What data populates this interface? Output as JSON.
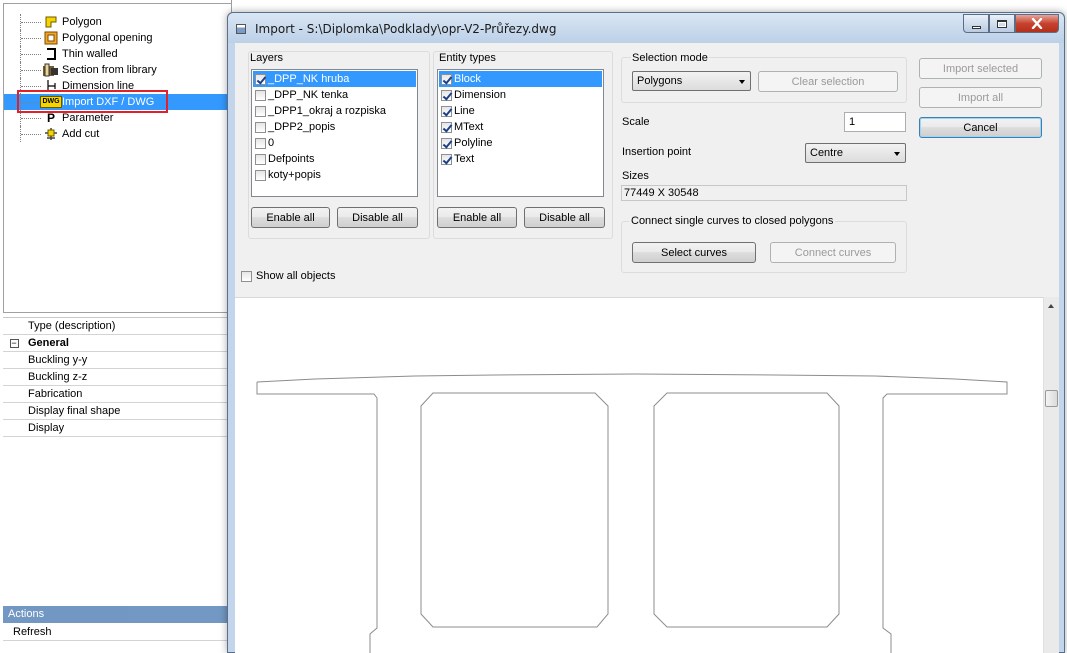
{
  "tree": {
    "items": [
      {
        "label": "Polygon",
        "icon": "polygon-icon"
      },
      {
        "label": "Polygonal opening",
        "icon": "polygonal-opening-icon"
      },
      {
        "label": "Thin walled",
        "icon": "thin-walled-icon"
      },
      {
        "label": "Section from library",
        "icon": "section-library-icon"
      },
      {
        "label": "Dimension line",
        "icon": "dimension-line-icon"
      },
      {
        "label": "Import DXF / DWG",
        "icon": "dwg-icon",
        "icon_text": "DWG",
        "selected": true
      },
      {
        "label": "Parameter",
        "icon": "parameter-icon",
        "icon_text": "P"
      },
      {
        "label": "Add cut",
        "icon": "add-cut-icon"
      }
    ]
  },
  "properties": {
    "rows": [
      {
        "label": "Type (description)"
      },
      {
        "label": "General",
        "group": true,
        "toggle": "−"
      },
      {
        "label": "Buckling y-y"
      },
      {
        "label": "Buckling z-z"
      },
      {
        "label": "Fabrication"
      },
      {
        "label": "Display final shape"
      },
      {
        "label": "Display"
      }
    ]
  },
  "actions": {
    "header": "Actions",
    "refresh": "Refresh"
  },
  "dialog": {
    "title": "Import - S:\\Diplomka\\Podklady\\opr-V2-Průřezy.dwg",
    "layers": {
      "label": "Layers",
      "items": [
        {
          "label": "_DPP_NK hruba",
          "checked": true,
          "selected": true
        },
        {
          "label": "_DPP_NK tenka",
          "checked": false
        },
        {
          "label": "_DPP1_okraj a rozpiska",
          "checked": false
        },
        {
          "label": "_DPP2_popis",
          "checked": false
        },
        {
          "label": "0",
          "checked": false
        },
        {
          "label": "Defpoints",
          "checked": false
        },
        {
          "label": "koty+popis",
          "checked": false
        }
      ],
      "enable_all": "Enable all",
      "disable_all": "Disable all"
    },
    "entity_types": {
      "label": "Entity types",
      "items": [
        {
          "label": "Block",
          "checked": true,
          "selected": true
        },
        {
          "label": "Dimension",
          "checked": true
        },
        {
          "label": "Line",
          "checked": true
        },
        {
          "label": "MText",
          "checked": true
        },
        {
          "label": "Polyline",
          "checked": true
        },
        {
          "label": "Text",
          "checked": true
        }
      ],
      "enable_all": "Enable all",
      "disable_all": "Disable all"
    },
    "selection_mode": {
      "label": "Selection mode",
      "value": "Polygons",
      "clear_selection": "Clear selection"
    },
    "scale": {
      "label": "Scale",
      "value": "1"
    },
    "insertion_point": {
      "label": "Insertion point",
      "value": "Centre"
    },
    "sizes": {
      "label": "Sizes",
      "value": "77449 X 30548"
    },
    "connect": {
      "label": "Connect single curves to closed polygons",
      "select_curves": "Select curves",
      "connect_curves": "Connect curves"
    },
    "show_all_objects": {
      "label": "Show all objects",
      "checked": false
    },
    "buttons": {
      "import_selected": "Import selected",
      "import_all": "Import all",
      "cancel": "Cancel"
    }
  },
  "colors": {
    "selection": "#3399ff",
    "highlight_frame": "#e0202a",
    "close_button": "#c7422e",
    "title_bar": "#c3d5ea"
  }
}
